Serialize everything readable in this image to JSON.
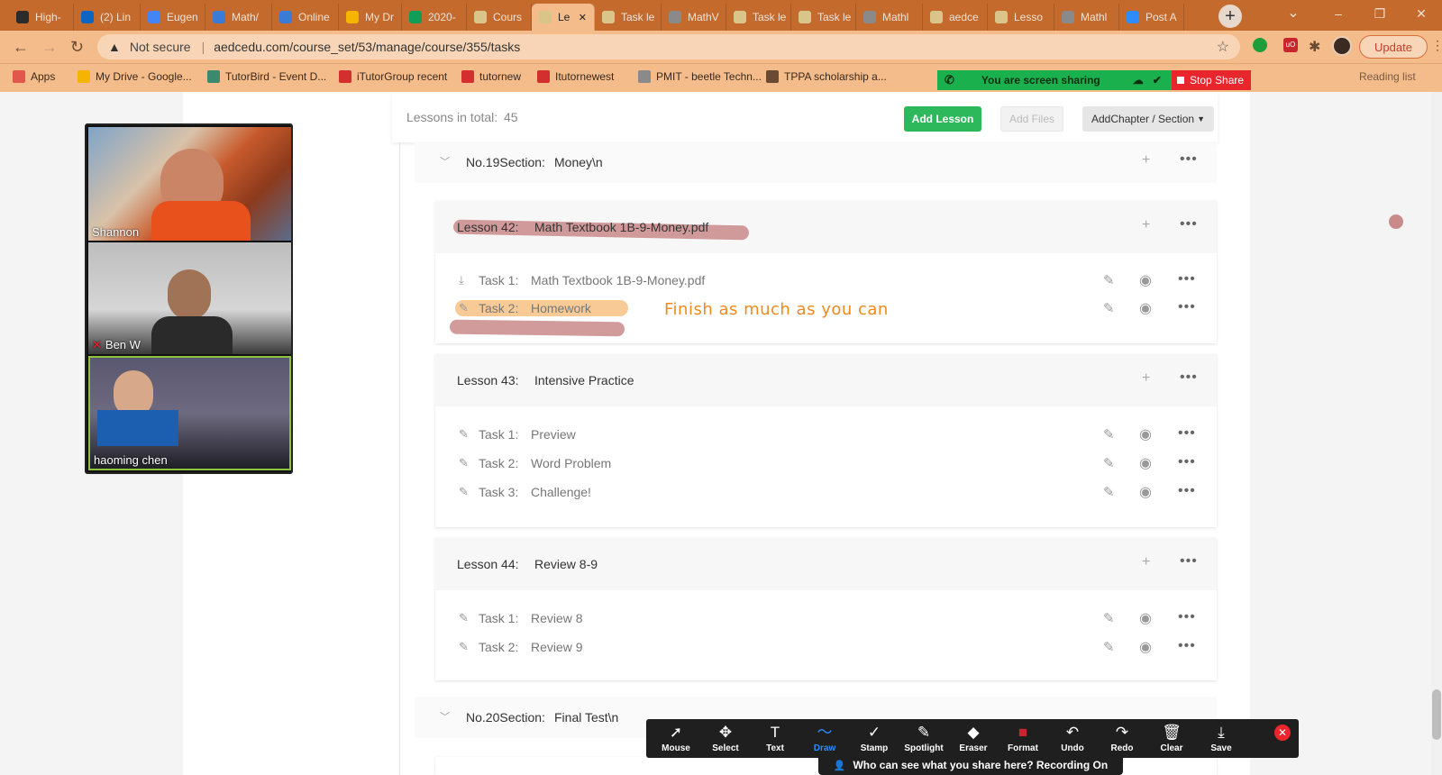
{
  "browser": {
    "tabs": [
      {
        "label": "High-",
        "icon": "ae-icon",
        "color": "#2b2b2b"
      },
      {
        "label": "(2) Lin",
        "icon": "linkedin-icon",
        "color": "#0a66c2"
      },
      {
        "label": "Eugen",
        "icon": "google-icon",
        "color": "#4285f4"
      },
      {
        "label": "Math/",
        "icon": "app-icon",
        "color": "#3a7bd5"
      },
      {
        "label": "Online",
        "icon": "app-icon",
        "color": "#3a7bd5"
      },
      {
        "label": "My Dr",
        "icon": "google-drive-icon",
        "color": "#f4b400"
      },
      {
        "label": "2020-",
        "icon": "google-sheets-icon",
        "color": "#0f9d58"
      },
      {
        "label": "Cours",
        "icon": "site-icon",
        "color": "#d9c58a"
      },
      {
        "label": "Le",
        "icon": "site-icon",
        "color": "#d9c58a"
      },
      {
        "label": "Task le",
        "icon": "site-icon",
        "color": "#d9c58a"
      },
      {
        "label": "MathV",
        "icon": "globe-icon",
        "color": "#8a8a8a"
      },
      {
        "label": "Task le",
        "icon": "site-icon",
        "color": "#d9c58a"
      },
      {
        "label": "Task le",
        "icon": "site-icon",
        "color": "#d9c58a"
      },
      {
        "label": "Mathl",
        "icon": "globe-icon",
        "color": "#8a8a8a"
      },
      {
        "label": "aedce",
        "icon": "site-icon",
        "color": "#d9c58a"
      },
      {
        "label": "Lesso",
        "icon": "site-icon",
        "color": "#d9c58a"
      },
      {
        "label": "Mathl",
        "icon": "globe-icon",
        "color": "#8a8a8a"
      },
      {
        "label": "Post A",
        "icon": "app-icon",
        "color": "#2d8cff"
      }
    ],
    "active_tab_index": 8,
    "security_label": "Not secure",
    "url": "aedcedu.com/course_set/53/manage/course/355/tasks",
    "update_label": "Update",
    "bookmarks": [
      {
        "label": "Apps",
        "color": "#e2574c"
      },
      {
        "label": "My Drive - Google...",
        "color": "#f4b400"
      },
      {
        "label": "TutorBird - Event D...",
        "color": "#3b8a6e"
      },
      {
        "label": "iTutorGroup recent",
        "color": "#d32f2f"
      },
      {
        "label": "tutornew",
        "color": "#d32f2f"
      },
      {
        "label": "Itutornewest",
        "color": "#d32f2f"
      },
      {
        "label": "PMIT - beetle Techn...",
        "color": "#8a8a8a"
      },
      {
        "label": "TPPA scholarship a...",
        "color": "#6a4a33"
      }
    ],
    "reading_list_label": "Reading list"
  },
  "screen_share": {
    "sharing_label": "You are screen sharing",
    "stop_label": "Stop Share"
  },
  "video": {
    "participants": [
      {
        "name": "Shannon"
      },
      {
        "name": "Ben W"
      },
      {
        "name": "haoming   chen"
      }
    ]
  },
  "page": {
    "lessons_total_label": "Lessons in total:",
    "lessons_total_value": "45",
    "add_lesson_label": "Add Lesson",
    "add_files_label": "Add Files",
    "add_chapter_label": "AddChapter / Section",
    "section19": {
      "prefix": "No.19Section:",
      "title": "Money\\n"
    },
    "lesson42": {
      "prefix": "Lesson 42:",
      "title": "Math Textbook 1B-9-Money.pdf",
      "tasks": [
        {
          "label": "Task 1:",
          "title": "Math Textbook 1B-9-Money.pdf",
          "icon": "download-icon"
        },
        {
          "label": "Task 2:",
          "title": "Homework",
          "icon": "pencil-icon"
        }
      ]
    },
    "lesson43": {
      "prefix": "Lesson 43:",
      "title": "Intensive Practice",
      "tasks": [
        {
          "label": "Task 1:",
          "title": "Preview",
          "icon": "pencil-icon"
        },
        {
          "label": "Task 2:",
          "title": "Word Problem",
          "icon": "pencil-icon"
        },
        {
          "label": "Task 3:",
          "title": "Challenge!",
          "icon": "pencil-icon"
        }
      ]
    },
    "lesson44": {
      "prefix": "Lesson 44:",
      "title": "Review 8-9",
      "tasks": [
        {
          "label": "Task 1:",
          "title": "Review 8",
          "icon": "pencil-icon"
        },
        {
          "label": "Task 2:",
          "title": "Review 9",
          "icon": "pencil-icon"
        }
      ]
    },
    "section20": {
      "prefix": "No.20Section:",
      "title": "Final Test\\n"
    }
  },
  "annotation": {
    "text": "Finish as much as you can",
    "color": "#f08a1e"
  },
  "zoom_toolbar": {
    "buttons": [
      {
        "label": "Mouse",
        "icon": "mouse-pointer-icon",
        "glyph": "➚"
      },
      {
        "label": "Select",
        "icon": "move-icon",
        "glyph": "✥"
      },
      {
        "label": "Text",
        "icon": "text-icon",
        "glyph": "T"
      },
      {
        "label": "Draw",
        "icon": "draw-icon",
        "glyph": "〜"
      },
      {
        "label": "Stamp",
        "icon": "stamp-check-icon",
        "glyph": "✓"
      },
      {
        "label": "Spotlight",
        "icon": "spotlight-icon",
        "glyph": "✎"
      },
      {
        "label": "Eraser",
        "icon": "eraser-icon",
        "glyph": "◆"
      },
      {
        "label": "Format",
        "icon": "format-icon",
        "glyph": "■"
      },
      {
        "label": "Undo",
        "icon": "undo-icon",
        "glyph": "↶"
      },
      {
        "label": "Redo",
        "icon": "redo-icon",
        "glyph": "↷"
      },
      {
        "label": "Clear",
        "icon": "trash-icon",
        "glyph": "🗑"
      },
      {
        "label": "Save",
        "icon": "save-icon",
        "glyph": "⤓"
      }
    ],
    "active_button": "Draw",
    "status_text": "Who can see what you share here? Recording On"
  },
  "colors": {
    "add_lesson_bg": "#2eb85c",
    "highlight_pink": "#c98a8a",
    "highlight_orange": "#f7c48a",
    "draw_active": "#2d8cff"
  }
}
